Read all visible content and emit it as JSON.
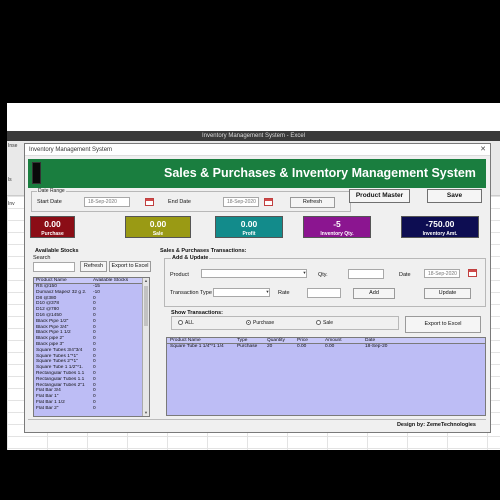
{
  "excel": {
    "title": "Inventory Management System - Excel",
    "side_texts": [
      "Inse",
      "ls",
      "Inv"
    ]
  },
  "dialog": {
    "title": "Inventory Management System",
    "close_glyph": "✕"
  },
  "banner": {
    "title": "Sales & Purchases & Inventory Management System",
    "color": "#1a7e3f"
  },
  "date_range": {
    "legend": "Date Range",
    "start_label": "Start Date",
    "start_value": "18-Sep-2020",
    "end_label": "End Date",
    "end_value": "18-Sep-2020",
    "refresh_label": "Refresh"
  },
  "toolbar": {
    "product_master_label": "Product Master",
    "save_label": "Save"
  },
  "cards": [
    {
      "value": "0.00",
      "caption": "Purchase",
      "color": "#8b0d16"
    },
    {
      "value": "0.00",
      "caption": "Sale",
      "color": "#9a9a14"
    },
    {
      "value": "0.00",
      "caption": "Profit",
      "color": "#128b8b"
    },
    {
      "value": "-5",
      "caption": "Inventory Qty.",
      "color": "#8b1590"
    },
    {
      "value": "-750.00",
      "caption": "Inventory Amt.",
      "color": "#0d0d52"
    }
  ],
  "stocks": {
    "title": "Available Stocks",
    "search_label": "Search",
    "search_value": "",
    "refresh_label": "Refresh",
    "export_label": "Export to Excel",
    "columns": [
      "Product Name",
      "Available Stocks"
    ],
    "rows": [
      [
        "RS @150",
        "-15"
      ],
      [
        "Dumaxz Mapeiz 32 g 2.",
        "-10"
      ],
      [
        "D8 @380",
        "0"
      ],
      [
        "D10 @378",
        "0"
      ],
      [
        "D12 @780",
        "0"
      ],
      [
        "D16 @1450",
        "0"
      ],
      [
        "Black Pipe 1/2\"",
        "0"
      ],
      [
        "Black Pipe 3/4\"",
        "0"
      ],
      [
        "Black Pipe 1 1/2",
        "0"
      ],
      [
        "Black pipe 2\"",
        "0"
      ],
      [
        "Black pipe 3\"",
        "0"
      ],
      [
        "Square Tubes 3/4\"3/4",
        "0"
      ],
      [
        "Square Tubes 1\"*1\"",
        "0"
      ],
      [
        "Square Tubes 2\"*1\"",
        "0"
      ],
      [
        "Square Tube 1 1/2\"*1.",
        "0"
      ],
      [
        "Rectangular Tubes 1.1",
        "0"
      ],
      [
        "Rectangular Tubes 1.1",
        "0"
      ],
      [
        "Rectangular Tubes 2\"1",
        "0"
      ],
      [
        "Flat Bar 3/4",
        "0"
      ],
      [
        "Flat Bar 1\"",
        "0"
      ],
      [
        "Flat Bar 1 1/2",
        "0"
      ],
      [
        "Flat Bar 2\"",
        "0"
      ]
    ]
  },
  "transactions": {
    "title": "Sales & Purchases Transactions:",
    "add_update_title": "Add & Update",
    "product_label": "Product",
    "product_value": "",
    "qty_label": "Qty.",
    "qty_value": "",
    "date_label": "Date",
    "date_value": "18-Sep-2020",
    "type_label": "Transaction Type",
    "type_value": "",
    "rate_label": "Rate",
    "rate_value": "",
    "add_label": "Add",
    "update_label": "Update",
    "show_title": "Show Transactions:",
    "radio_all": "ALL",
    "radio_purchase": "Purchase",
    "radio_sale": "Sale",
    "radio_selected": "Purchase",
    "export_label": "Export to Excel",
    "columns": [
      "Product Name",
      "Type",
      "Quantity",
      "Price",
      "Amount",
      "Date"
    ],
    "rows": [
      [
        "Square Tube 1 1/4\"*1 1/4",
        "Purchase",
        "20",
        "0.00",
        "0.00",
        "18-Sep-20"
      ]
    ]
  },
  "footer": {
    "credit": "Design by: ZemeTechnologies"
  }
}
